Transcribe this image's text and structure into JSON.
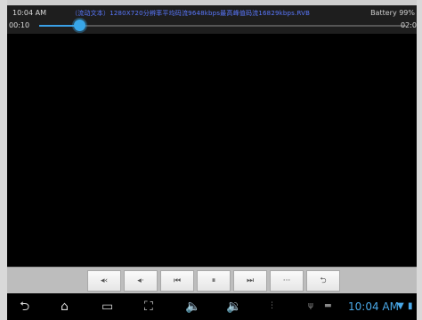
{
  "status": {
    "time": "10:04 AM",
    "battery": "Battery 99%",
    "marquee": "（流动文本）1280X720分辨率平均码流9648kbps最高峰值码流16829kbps.RVB"
  },
  "player": {
    "elapsed": "00:10",
    "duration": "02:0",
    "progress_fraction": 0.11
  },
  "controls": [
    {
      "name": "rewind-button",
      "glyph": "◂‹",
      "icon": "rewind-icon"
    },
    {
      "name": "step-back-button",
      "glyph": "◂·",
      "icon": "step-back-icon"
    },
    {
      "name": "previous-button",
      "glyph": "⏮",
      "icon": "previous-icon"
    },
    {
      "name": "pause-button",
      "glyph": "⏸",
      "icon": "pause-icon"
    },
    {
      "name": "next-button",
      "glyph": "⏭",
      "icon": "next-icon"
    },
    {
      "name": "more-button",
      "glyph": "···",
      "icon": "more-icon"
    },
    {
      "name": "return-button",
      "glyph": "⮌",
      "icon": "return-icon"
    }
  ],
  "navbar": {
    "time": "10:04 AM",
    "icons": [
      "back-icon",
      "home-icon",
      "recent-apps-icon",
      "screenshot-icon",
      "volume-down-icon",
      "volume-up-icon",
      "menu-icon"
    ]
  },
  "colors": {
    "accent": "#38a6e8",
    "marquee": "#5a78ff",
    "control_bar": "#bdbdbd"
  }
}
